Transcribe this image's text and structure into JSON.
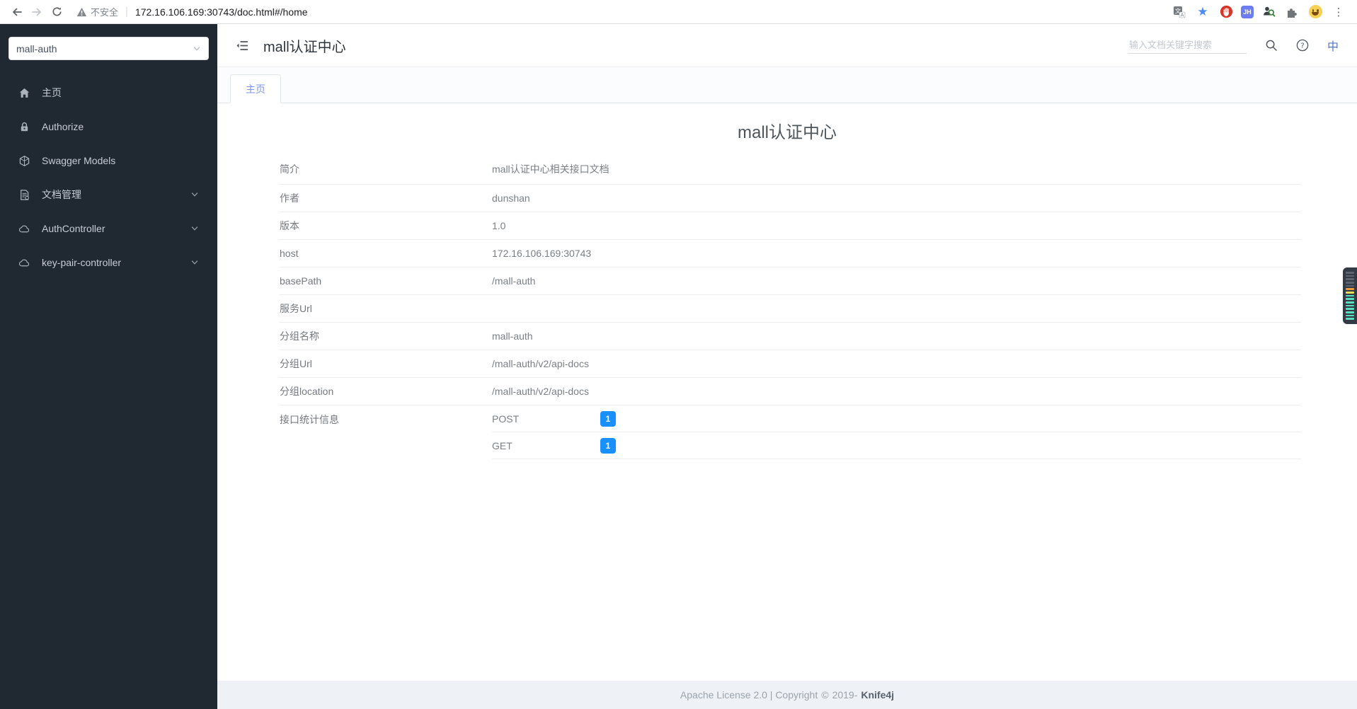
{
  "browser": {
    "security_label": "不安全",
    "url": "172.16.106.169:30743/doc.html#/home",
    "extension_jh_label": "JH"
  },
  "sidebar": {
    "group_select_value": "mall-auth",
    "items": [
      {
        "label": "主页",
        "icon": "home-icon",
        "expandable": false
      },
      {
        "label": "Authorize",
        "icon": "lock-icon",
        "expandable": false
      },
      {
        "label": "Swagger Models",
        "icon": "models-icon",
        "expandable": false
      },
      {
        "label": "文档管理",
        "icon": "document-icon",
        "expandable": true
      },
      {
        "label": "AuthController",
        "icon": "cloud-icon",
        "expandable": true
      },
      {
        "label": "key-pair-controller",
        "icon": "cloud-icon",
        "expandable": true
      }
    ]
  },
  "header": {
    "title": "mall认证中心",
    "search_placeholder": "输入文档关键字搜索",
    "lang_label": "中"
  },
  "tabs": [
    {
      "label": "主页",
      "active": true
    }
  ],
  "main": {
    "page_title": "mall认证中心",
    "info_rows": [
      {
        "label": "简介",
        "value": "mall认证中心相关接口文档"
      },
      {
        "label": "作者",
        "value": "dunshan"
      },
      {
        "label": "版本",
        "value": "1.0"
      },
      {
        "label": "host",
        "value": "172.16.106.169:30743"
      },
      {
        "label": "basePath",
        "value": "/mall-auth"
      },
      {
        "label": "服务Url",
        "value": ""
      },
      {
        "label": "分组名称",
        "value": "mall-auth"
      },
      {
        "label": "分组Url",
        "value": "/mall-auth/v2/api-docs"
      },
      {
        "label": "分组location",
        "value": "/mall-auth/v2/api-docs"
      }
    ],
    "stats_label": "接口统计信息",
    "stats": [
      {
        "method": "POST",
        "count": "1"
      },
      {
        "method": "GET",
        "count": "1"
      }
    ]
  },
  "footer": {
    "license_text": "Apache License 2.0 | Copyright",
    "copyright_symbol": "©",
    "year_text": "2019-",
    "brand": "Knife4j"
  },
  "colors": {
    "badge": "#1890ff",
    "tab_active_text": "#7d93f2",
    "sidebar_bg": "#202932",
    "footer_bg": "#eef1f5",
    "edge_stripe_orange": "#e89a3c",
    "edge_stripe_yellow": "#e8df52",
    "edge_stripe_teal": "#58dfc0",
    "edge_stripe_gray": "#5c6470"
  }
}
